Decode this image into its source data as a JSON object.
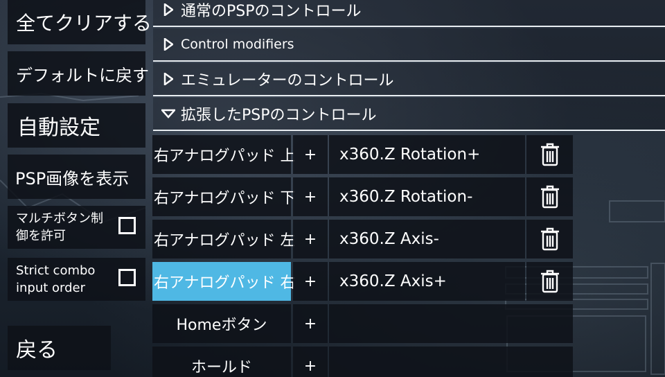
{
  "left_panel": {
    "clear_all": "全てクリアする",
    "reset_default": "デフォルトに戻す",
    "auto_config": "自動設定",
    "show_psp": "PSP画像を表示",
    "multi_button": {
      "label": "マルチボタン制御を許可",
      "checked": false
    },
    "strict_combo": {
      "label": "Strict combo input order",
      "checked": false
    },
    "back": "戻る"
  },
  "sections": [
    {
      "label": "通常のPSPのコントロール",
      "expanded": false
    },
    {
      "label": "Control modifiers",
      "expanded": false
    },
    {
      "label": "エミュレーターのコントロール",
      "expanded": false
    },
    {
      "label": "拡張したPSPのコントロール",
      "expanded": true
    }
  ],
  "mappings": [
    {
      "label": "右アナログパッド 上",
      "plus": "+",
      "mapping": "x360.Z Rotation+",
      "delete_icon": "trash-icon",
      "selected": false
    },
    {
      "label": "右アナログパッド 下",
      "plus": "+",
      "mapping": "x360.Z Rotation-",
      "delete_icon": "trash-icon",
      "selected": false
    },
    {
      "label": "右アナログパッド 左",
      "plus": "+",
      "mapping": "x360.Z Axis-",
      "delete_icon": "trash-icon",
      "selected": false
    },
    {
      "label": "右アナログパッド 右",
      "plus": "+",
      "mapping": "x360.Z Axis+",
      "delete_icon": "trash-icon",
      "selected": true
    },
    {
      "label": "Homeボタン",
      "plus": "+",
      "mapping": "",
      "selected": false
    },
    {
      "label": "ホールド",
      "plus": "+",
      "mapping": "",
      "selected": false
    }
  ],
  "colors": {
    "selected": "#4fb8e4",
    "panel": "#0e1218",
    "divider": "#e9eef2",
    "text": "#ffffff"
  }
}
